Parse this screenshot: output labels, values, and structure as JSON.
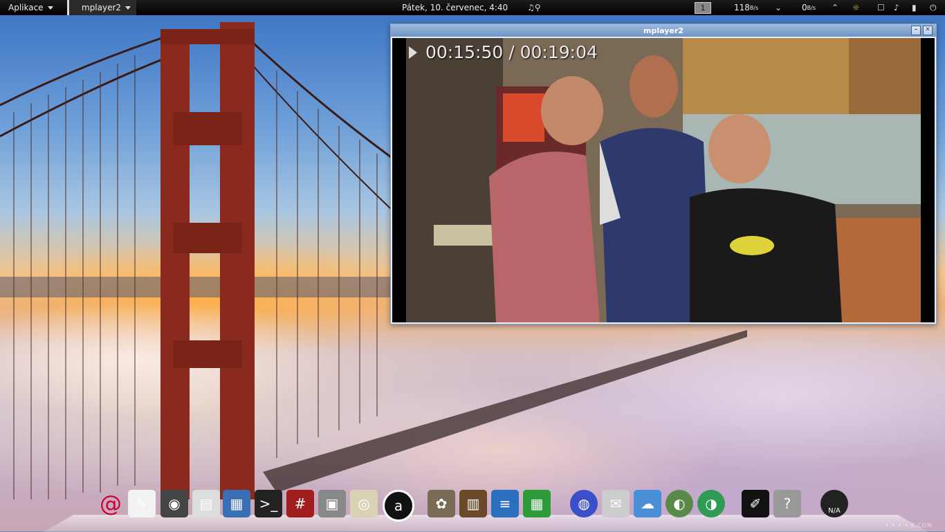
{
  "top_panel": {
    "apps_menu_label": "Aplikace",
    "active_task_label": "mplayer2",
    "clock": "Pátek, 10. červenec,  4:40",
    "workspace_number": "1",
    "net_down": "118",
    "net_down_unit": "B/s",
    "net_up": "0",
    "net_up_unit": "B/s"
  },
  "window": {
    "title": "mplayer2",
    "osd_time": "00:15:50 / 00:19:04"
  },
  "dock": {
    "items": [
      {
        "name": "debian-icon",
        "glyph": "@",
        "color": "#cc0033"
      },
      {
        "name": "text-editor-icon",
        "glyph": "✎",
        "color": "#f2f2f2"
      },
      {
        "name": "camera-icon",
        "glyph": "◉",
        "color": "#444"
      },
      {
        "name": "file-cabinet-icon",
        "glyph": "▤",
        "color": "#ddd"
      },
      {
        "name": "disk-utility-icon",
        "glyph": "▦",
        "color": "#3a6fb5"
      },
      {
        "name": "terminal-icon",
        "glyph": ">_",
        "color": "#222"
      },
      {
        "name": "root-terminal-icon",
        "glyph": "#",
        "color": "#a01e1e"
      },
      {
        "name": "package-installer-icon",
        "glyph": "▣",
        "color": "#888"
      },
      {
        "name": "speaker-icon",
        "glyph": "◎",
        "color": "#d9d2b4"
      },
      {
        "name": "amazon-icon",
        "glyph": "a",
        "color": "#111"
      },
      {
        "name": "gimp-icon",
        "glyph": "✿",
        "color": "#7a6b55"
      },
      {
        "name": "library-icon",
        "glyph": "▥",
        "color": "#6b4a2b"
      },
      {
        "name": "writer-document-icon",
        "glyph": "≡",
        "color": "#2c6fbf"
      },
      {
        "name": "calc-spreadsheet-icon",
        "glyph": "▦",
        "color": "#2e9b3a"
      },
      {
        "name": "browser-globe-icon",
        "glyph": "◍",
        "color": "#3b4fc9"
      },
      {
        "name": "mail-clock-icon",
        "glyph": "✉",
        "color": "#ccc"
      },
      {
        "name": "chat-bubble-icon",
        "glyph": "☁",
        "color": "#4a90d9"
      },
      {
        "name": "network-globe-icon",
        "glyph": "◐",
        "color": "#5a8a4a"
      },
      {
        "name": "web-globe-icon",
        "glyph": "◑",
        "color": "#2f9b55"
      },
      {
        "name": "notes-icon",
        "glyph": "✐",
        "color": "#111"
      },
      {
        "name": "unknown-app-icon",
        "glyph": "?",
        "color": "#999"
      },
      {
        "name": "speedometer-icon",
        "glyph": "◔",
        "color": "#222"
      }
    ],
    "na_label": "N/A"
  }
}
